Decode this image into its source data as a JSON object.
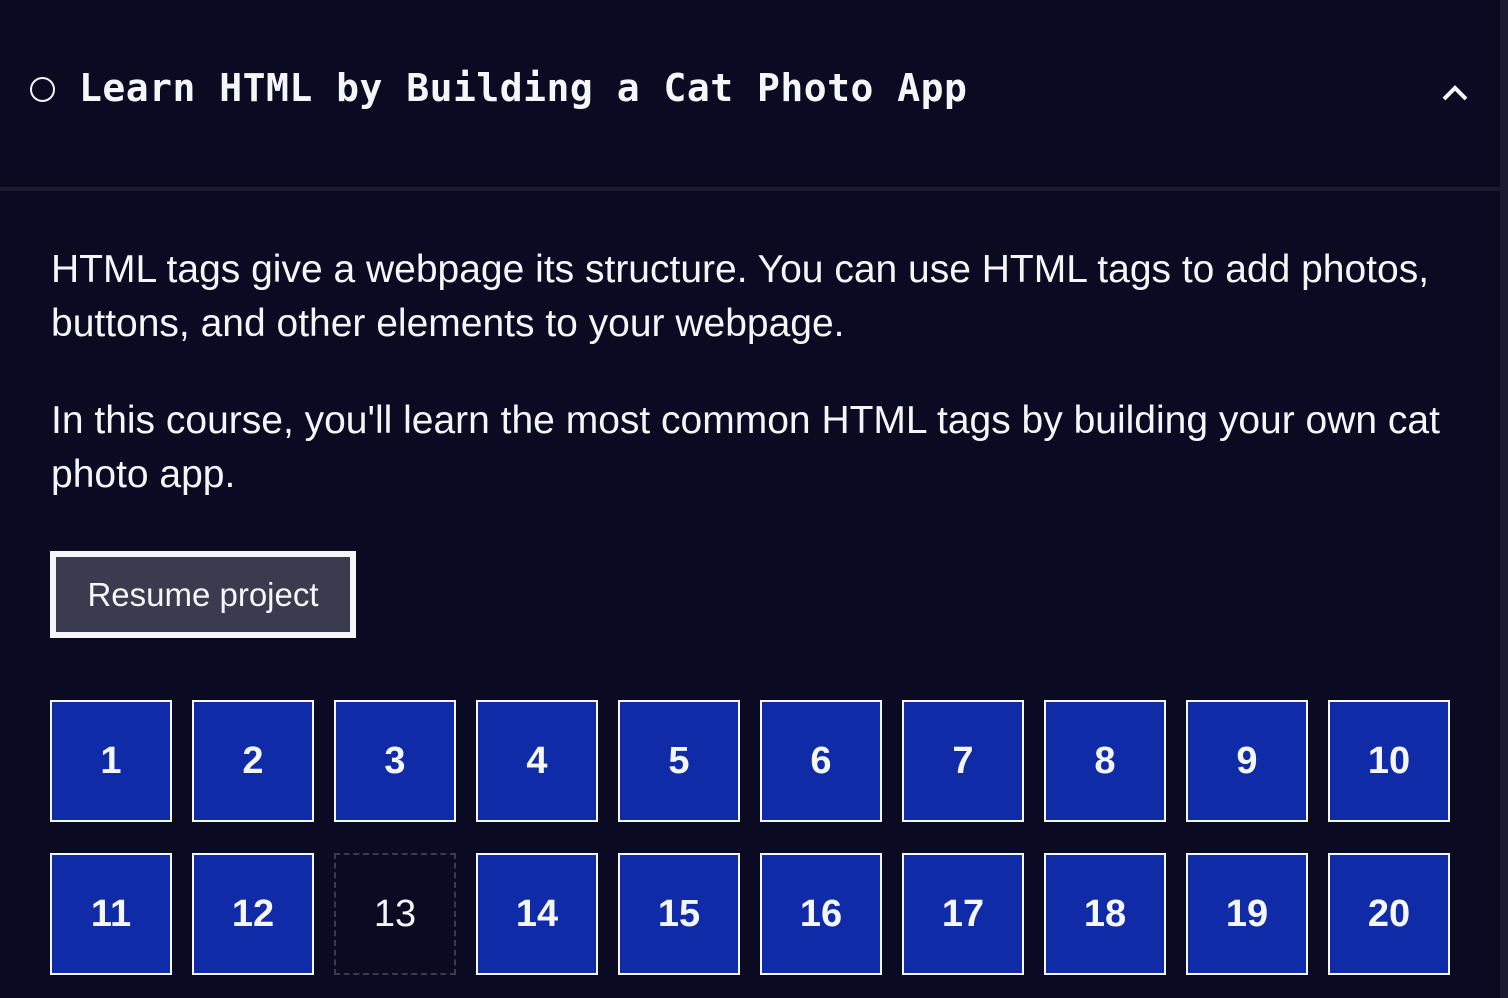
{
  "header": {
    "title": "Learn HTML by Building a Cat Photo App",
    "status_icon": "circle-icon",
    "toggle_icon": "chevron-up-icon"
  },
  "description": [
    "HTML tags give a webpage its structure. You can use HTML tags to add photos, buttons, and other elements to your webpage.",
    "In this course, you'll learn the most common HTML tags by building your own cat photo app."
  ],
  "resume_label": "Resume project",
  "steps": [
    {
      "label": "1",
      "completed": true
    },
    {
      "label": "2",
      "completed": true
    },
    {
      "label": "3",
      "completed": true
    },
    {
      "label": "4",
      "completed": true
    },
    {
      "label": "5",
      "completed": true
    },
    {
      "label": "6",
      "completed": true
    },
    {
      "label": "7",
      "completed": true
    },
    {
      "label": "8",
      "completed": true
    },
    {
      "label": "9",
      "completed": true
    },
    {
      "label": "10",
      "completed": true
    },
    {
      "label": "11",
      "completed": true
    },
    {
      "label": "12",
      "completed": true
    },
    {
      "label": "13",
      "completed": false
    },
    {
      "label": "14",
      "completed": true
    },
    {
      "label": "15",
      "completed": true
    },
    {
      "label": "16",
      "completed": true
    },
    {
      "label": "17",
      "completed": true
    },
    {
      "label": "18",
      "completed": true
    },
    {
      "label": "19",
      "completed": true
    },
    {
      "label": "20",
      "completed": true
    }
  ],
  "colors": {
    "background": "#0a0a23",
    "completed": "#0f2ba8",
    "button": "#3b3b4f"
  }
}
